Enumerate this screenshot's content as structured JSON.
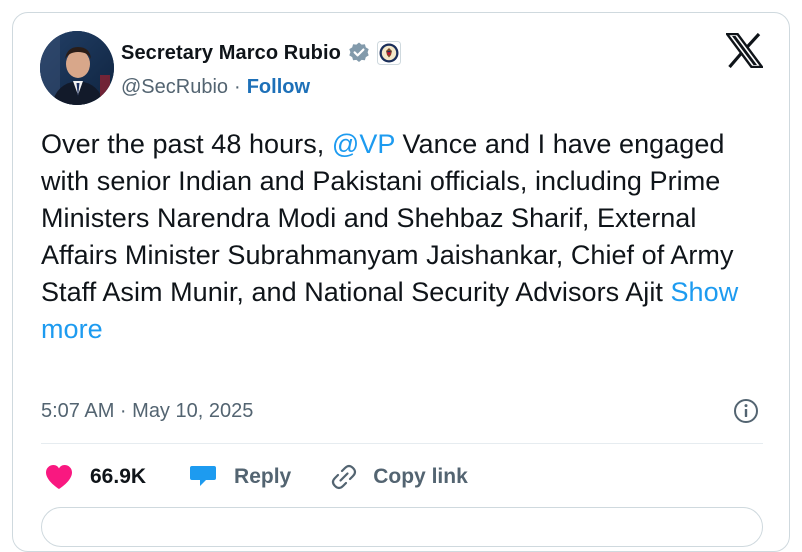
{
  "author": {
    "name": "Secretary Marco Rubio",
    "handle": "@SecRubio",
    "separator": "·",
    "follow_label": "Follow"
  },
  "icons": {
    "verified": "verified-badge-icon",
    "affiliation": "state-department-seal-icon",
    "brand": "x-logo-icon",
    "info": "info-icon",
    "like": "heart-icon",
    "reply": "reply-bubble-icon",
    "copy": "link-icon"
  },
  "tweet": {
    "text_before": "Over the past 48 hours, ",
    "mention": "@VP",
    "text_after": " Vance and I have engaged with senior Indian and Pakistani officials, including Prime Ministers Narendra Modi and Shehbaz Sharif, External Affairs Minister Subrahmanyam Jaishankar, Chief of Army Staff Asim Munir, and National Security Advisors Ajit ",
    "show_more": "Show more",
    "timestamp": "5:07 AM · May 10, 2025"
  },
  "actions": {
    "likes": "66.9K",
    "reply_label": "Reply",
    "copy_label": "Copy link"
  },
  "colors": {
    "text": "#0f1419",
    "secondary": "#536471",
    "link": "#1d9bf0",
    "follow": "#1d70b8",
    "like": "#f91880",
    "reply": "#1d9bf0",
    "verified": "#829aab",
    "border": "#cfd9de"
  }
}
